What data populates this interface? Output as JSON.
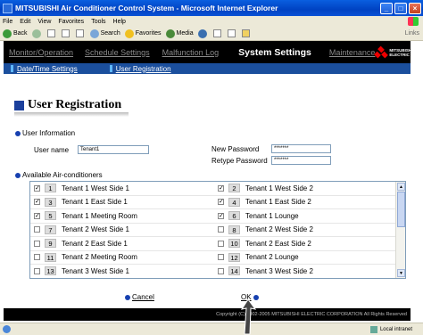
{
  "window": {
    "title": "MITSUBISHI Air Conditioner Control System - Microsoft Internet Explorer"
  },
  "menu": [
    "File",
    "Edit",
    "View",
    "Favorites",
    "Tools",
    "Help"
  ],
  "toolbar": {
    "back": "Back",
    "search": "Search",
    "favorites": "Favorites",
    "media": "Media",
    "links": "Links"
  },
  "nav": {
    "items": [
      "Monitor/Operation",
      "Schedule Settings",
      "Malfunction Log",
      "System Settings",
      "Maintenance"
    ],
    "active": "System Settings",
    "brand_line1": "MITSUBISHI",
    "brand_line2": "ELECTRIC"
  },
  "subnav": [
    "Date/Time Settings",
    "User Registration"
  ],
  "page": {
    "title": "User Registration",
    "user_info_label": "User Information",
    "user_name_label": "User name",
    "user_name_value": "Tenant1",
    "new_password_label": "New Password",
    "new_password_value": "*******",
    "retype_password_label": "Retype Password",
    "retype_password_value": "*******",
    "available_label": "Available Air-conditioners"
  },
  "air_conditioners": [
    {
      "left": {
        "num": "1",
        "name": "Tenant 1 West Side 1",
        "checked": true
      },
      "right": {
        "num": "2",
        "name": "Tenant 1 West Side 2",
        "checked": true
      }
    },
    {
      "left": {
        "num": "3",
        "name": "Tenant 1 East Side 1",
        "checked": true
      },
      "right": {
        "num": "4",
        "name": "Tenant 1 East Side 2",
        "checked": true
      }
    },
    {
      "left": {
        "num": "5",
        "name": "Tenant 1 Meeting Room",
        "checked": true
      },
      "right": {
        "num": "6",
        "name": "Tenant 1 Lounge",
        "checked": true
      }
    },
    {
      "left": {
        "num": "7",
        "name": "Tenant 2 West Side 1",
        "checked": false
      },
      "right": {
        "num": "8",
        "name": "Tenant 2 West Side 2",
        "checked": false
      }
    },
    {
      "left": {
        "num": "9",
        "name": "Tenant 2 East Side 1",
        "checked": false
      },
      "right": {
        "num": "10",
        "name": "Tenant 2 East Side 2",
        "checked": false
      }
    },
    {
      "left": {
        "num": "11",
        "name": "Tenant 2 Meeting Room",
        "checked": false
      },
      "right": {
        "num": "12",
        "name": "Tenant 2 Lounge",
        "checked": false
      }
    },
    {
      "left": {
        "num": "13",
        "name": "Tenant 3 West Side 1",
        "checked": false
      },
      "right": {
        "num": "14",
        "name": "Tenant 3 West Side 2",
        "checked": false
      }
    }
  ],
  "actions": {
    "cancel": "Cancel",
    "ok": "OK"
  },
  "footer": "Copyright (C) 2002-2005 MITSUBISHI ELECTRIC CORPORATION All Rights Reserved",
  "status": {
    "zone": "Local intranet"
  },
  "colors": {
    "accent_blue": "#1740b0",
    "nav_bar": "#000000",
    "subnav": "#1b4f9d",
    "brand_red": "#e00000"
  }
}
